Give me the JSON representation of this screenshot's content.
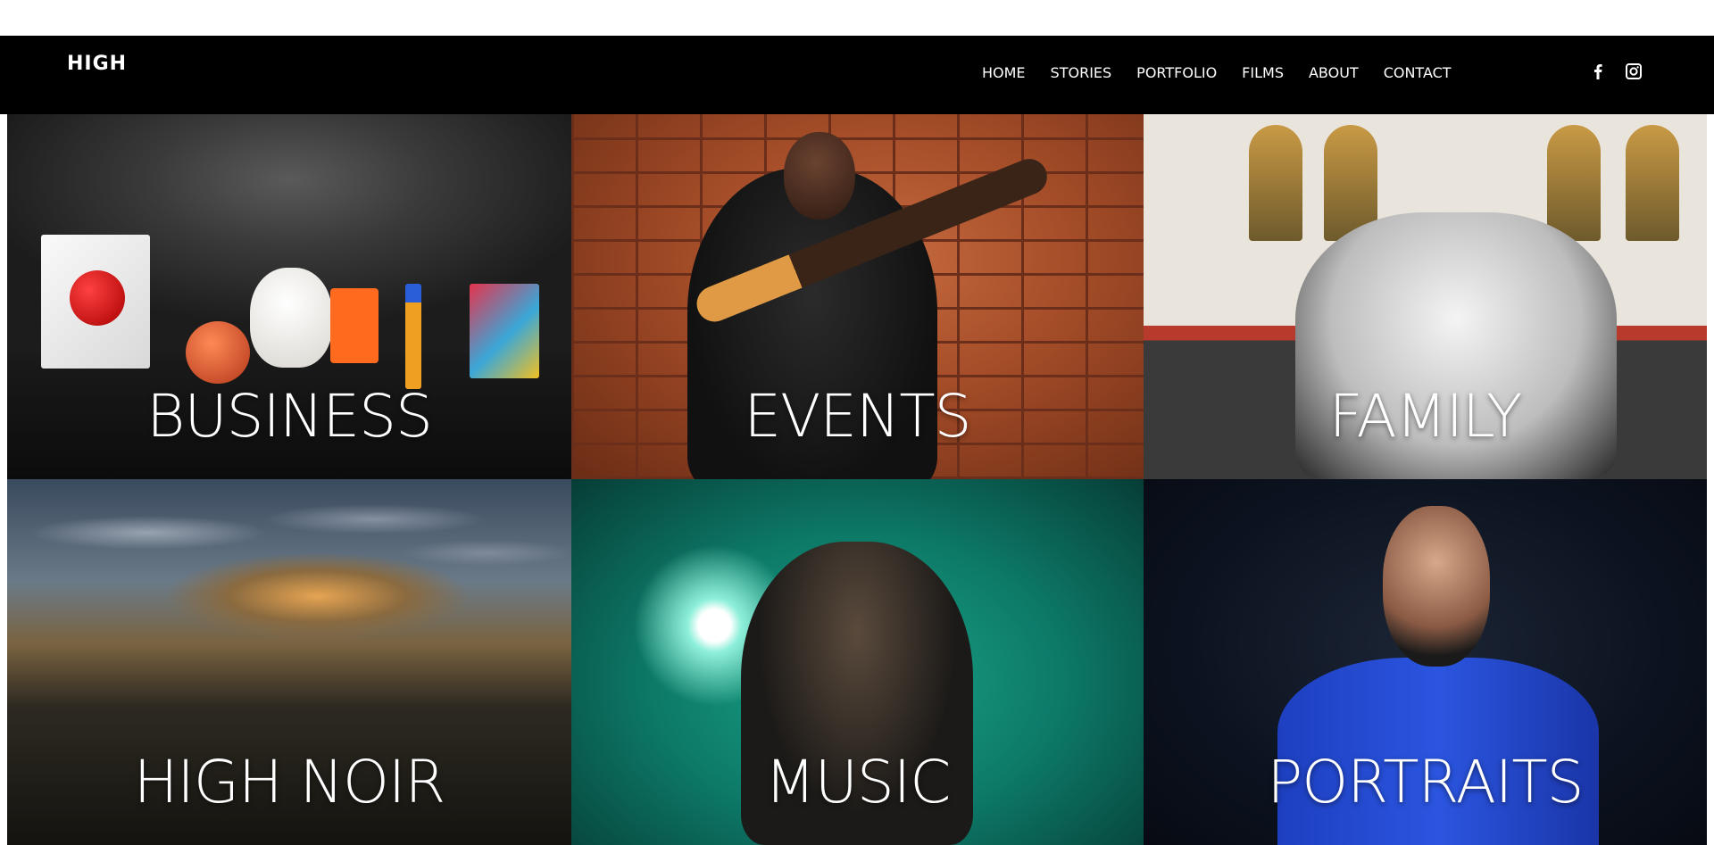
{
  "header": {
    "logo": "HIGH",
    "nav": [
      {
        "label": "HOME"
      },
      {
        "label": "STORIES"
      },
      {
        "label": "PORTFOLIO"
      },
      {
        "label": "FILMS"
      },
      {
        "label": "ABOUT"
      },
      {
        "label": "CONTACT"
      }
    ],
    "social": [
      {
        "icon": "facebook-icon"
      },
      {
        "icon": "instagram-icon"
      }
    ]
  },
  "gallery": {
    "tiles": [
      {
        "label": "BUSINESS"
      },
      {
        "label": "EVENTS"
      },
      {
        "label": "FAMILY"
      },
      {
        "label": "HIGH NOIR"
      },
      {
        "label": "MUSIC"
      },
      {
        "label": "PORTRAITS"
      }
    ]
  }
}
